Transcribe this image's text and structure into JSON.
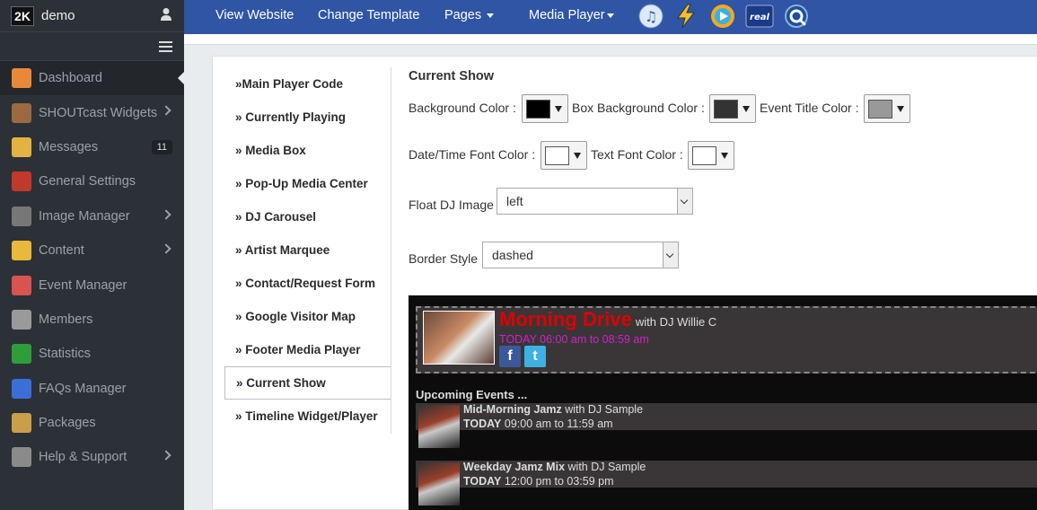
{
  "brand": {
    "logo": "2K",
    "name": "demo"
  },
  "sidebar": {
    "items": [
      {
        "label": "Dashboard",
        "icon": "home-icon",
        "color": "#e8893a",
        "active": true
      },
      {
        "label": "SHOUTcast Widgets",
        "icon": "widgets-icon",
        "color": "#9a6a40",
        "submenu": true
      },
      {
        "label": "Messages",
        "icon": "mail-icon",
        "color": "#e2b341",
        "badge": "11"
      },
      {
        "label": "General Settings",
        "icon": "tools-icon",
        "color": "#c0392b"
      },
      {
        "label": "Image Manager",
        "icon": "film-icon",
        "color": "#777777",
        "submenu": true
      },
      {
        "label": "Content",
        "icon": "folder-icon",
        "color": "#e8b93a",
        "submenu": true
      },
      {
        "label": "Event Manager",
        "icon": "calendar-icon",
        "color": "#d9534f"
      },
      {
        "label": "Members",
        "icon": "members-icon",
        "color": "#9a9a9a"
      },
      {
        "label": "Statistics",
        "icon": "stats-icon",
        "color": "#2e9e3a"
      },
      {
        "label": "FAQs Manager",
        "icon": "help-icon",
        "color": "#3a6fd8"
      },
      {
        "label": "Packages",
        "icon": "packages-icon",
        "color": "#c9a04a"
      },
      {
        "label": "Help & Support",
        "icon": "support-icon",
        "color": "#8a8a8a",
        "submenu": true
      }
    ]
  },
  "topbar": {
    "links": [
      "View Website",
      "Change Template",
      "Pages",
      "Media Player"
    ],
    "player_icons": [
      "itunes-icon",
      "winamp-icon",
      "windows-media-icon",
      "real-player-icon",
      "quicktime-icon"
    ]
  },
  "tabs": [
    "»Main Player Code",
    "» Currently Playing",
    "» Media Box",
    "» Pop-Up Media Center",
    "» DJ Carousel",
    "» Artist Marquee",
    "» Contact/Request Form",
    "» Google Visitor Map",
    "» Footer Media Player",
    "» Current Show",
    "» Timeline Widget/Player"
  ],
  "active_tab": 9,
  "form": {
    "section_title": "Current Show",
    "background_color_label": "Background Color :",
    "background_color": "#000000",
    "box_background_color_label": "Box Background Color :",
    "box_background_color": "#333333",
    "event_title_color_label": "Event Title Color :",
    "event_title_color": "#999999",
    "datetime_font_color_label": "Date/Time Font Color :",
    "datetime_font_color": "#ffffff",
    "text_font_color_label": "Text Font Color :",
    "text_font_color": "#ffffff",
    "float_dj_image_label": "Float DJ Image",
    "float_dj_image_value": "left",
    "border_style_label": "Border Style",
    "border_style_value": "dashed"
  },
  "preview": {
    "show_title": "Morning Drive",
    "show_dj": "with DJ Willie C",
    "show_time": "TODAY 06:00 am to 08:59 am",
    "upcoming_title": "Upcoming Events ...",
    "events": [
      {
        "name": "Mid-Morning Jamz",
        "dj": "with DJ Sample",
        "day": "TODAY",
        "time": "09:00 am to 11:59 am"
      },
      {
        "name": "Weekday Jamz Mix",
        "dj": "with DJ Sample",
        "day": "TODAY",
        "time": "12:00 pm to 03:59 pm"
      }
    ]
  }
}
